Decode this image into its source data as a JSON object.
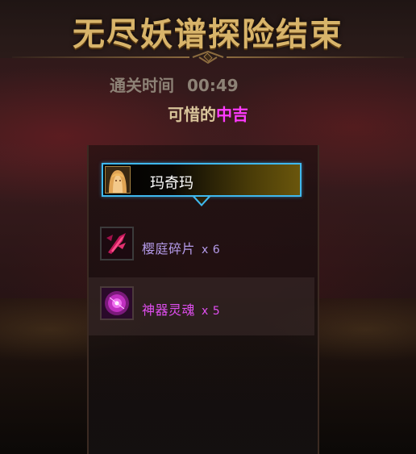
{
  "title": "无尽妖谱探险结束",
  "clear_time": {
    "label": "通关时间",
    "value": "00:49"
  },
  "rating": {
    "prefix": "可惜的",
    "grade": "中吉"
  },
  "player": {
    "name": "玛奇玛",
    "avatar_icon": "character-portrait-icon"
  },
  "loot": [
    {
      "name": "樱庭碎片",
      "quantity": "x 6",
      "icon": "sakura-shard-icon",
      "color": "#b49ae8"
    },
    {
      "name": "神器灵魂",
      "quantity": "x 5",
      "icon": "artifact-soul-icon",
      "color": "#e04ef0"
    }
  ],
  "colors": {
    "title_gold": "#d8b46a",
    "grade_magenta": "#ff3bff",
    "highlight_border": "#3fb8ee"
  }
}
